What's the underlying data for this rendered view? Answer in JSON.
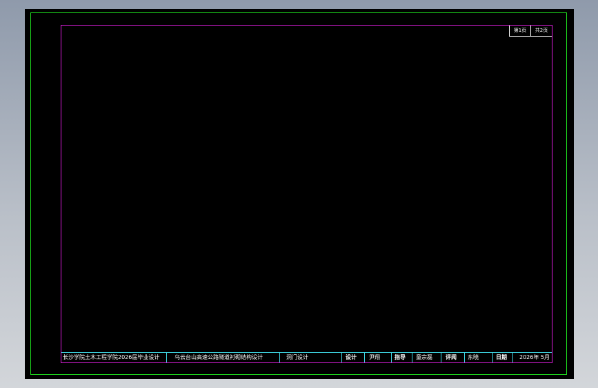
{
  "sheet_number": {
    "current": "第1页",
    "total": "共2页"
  },
  "title_block": {
    "school": "长沙学院土木工程学院2026届毕业设计",
    "project": "乌云台山高速公路隧道衬砌结构设计",
    "drawing": "洞门设计",
    "design_label": "设计",
    "designer": "尹翔",
    "advisor_label": "指导",
    "advisor": "童宗磊",
    "review_label": "评阅",
    "reviewer": "东晓",
    "date_label": "日期",
    "date": "2026年 5月"
  },
  "colors": {
    "background": "#000000",
    "outer_frame": "#1edc1e",
    "inner_frame": "#e01ee0",
    "title_lines": "#3fd9e6",
    "text": "#ffffff"
  }
}
